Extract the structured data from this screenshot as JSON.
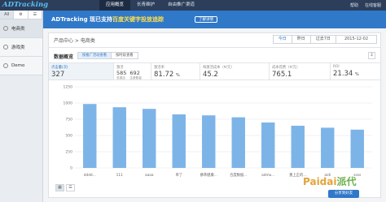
{
  "app": {
    "logo": "ADTracking"
  },
  "topnav": [
    {
      "label": "应用概览"
    },
    {
      "label": "长青维护"
    },
    {
      "label": "自由推广渠道"
    }
  ],
  "topright": [
    "帮助",
    "在线客服"
  ],
  "sidebar": {
    "tabs": [
      "All",
      "⚙",
      "☰"
    ],
    "items": [
      {
        "label": "电商类"
      },
      {
        "label": "游戏类"
      },
      {
        "label": "Demo"
      }
    ]
  },
  "banner": {
    "message_prefix": "ADTracking 现已支持",
    "message_highlight": "百度关键字投放追踪",
    "button": "了解详情"
  },
  "breadcrumb": "产品中心 > 电商类",
  "datebar": {
    "items": [
      "今日",
      "昨日",
      "过去7日"
    ],
    "date": "2015-12-02"
  },
  "section": {
    "title": "数据概览",
    "toggle": [
      "按推广活动查看",
      "按时段查看"
    ],
    "download": "⇩"
  },
  "metrics": [
    {
      "label": "点击量(次)",
      "value": "327"
    },
    {
      "label": "激活",
      "pair": [
        {
          "num": "585",
          "sub": "总激活"
        },
        {
          "num": "692",
          "sub": "注册数量"
        }
      ]
    },
    {
      "label": "激活率",
      "value": "81.72",
      "unit": "%"
    },
    {
      "label": "每激活成本（¥/元）",
      "value": "45.2"
    },
    {
      "label": "成本花费（¥/元）",
      "value": "765.1"
    },
    {
      "label": "ROI",
      "value": "21.34",
      "unit": "%"
    }
  ],
  "chart_data": {
    "type": "bar",
    "categories": [
      "dddd...",
      "111",
      "aaaa",
      "单了",
      "拂革健康...",
      "百度数据...",
      "admo...",
      "重上正的...",
      "aidi",
      "ssss"
    ],
    "values": [
      985,
      935,
      910,
      825,
      810,
      780,
      700,
      650,
      620,
      590
    ],
    "yticks": [
      0,
      250,
      500,
      750,
      1000,
      1250
    ],
    "ylim": [
      0,
      1250
    ],
    "color": "#7db4e8"
  },
  "charttype": [
    "▦",
    "☰"
  ],
  "watermark": {
    "part1": "Paidai",
    "part2": "派代"
  },
  "share_button": "分享到好友"
}
